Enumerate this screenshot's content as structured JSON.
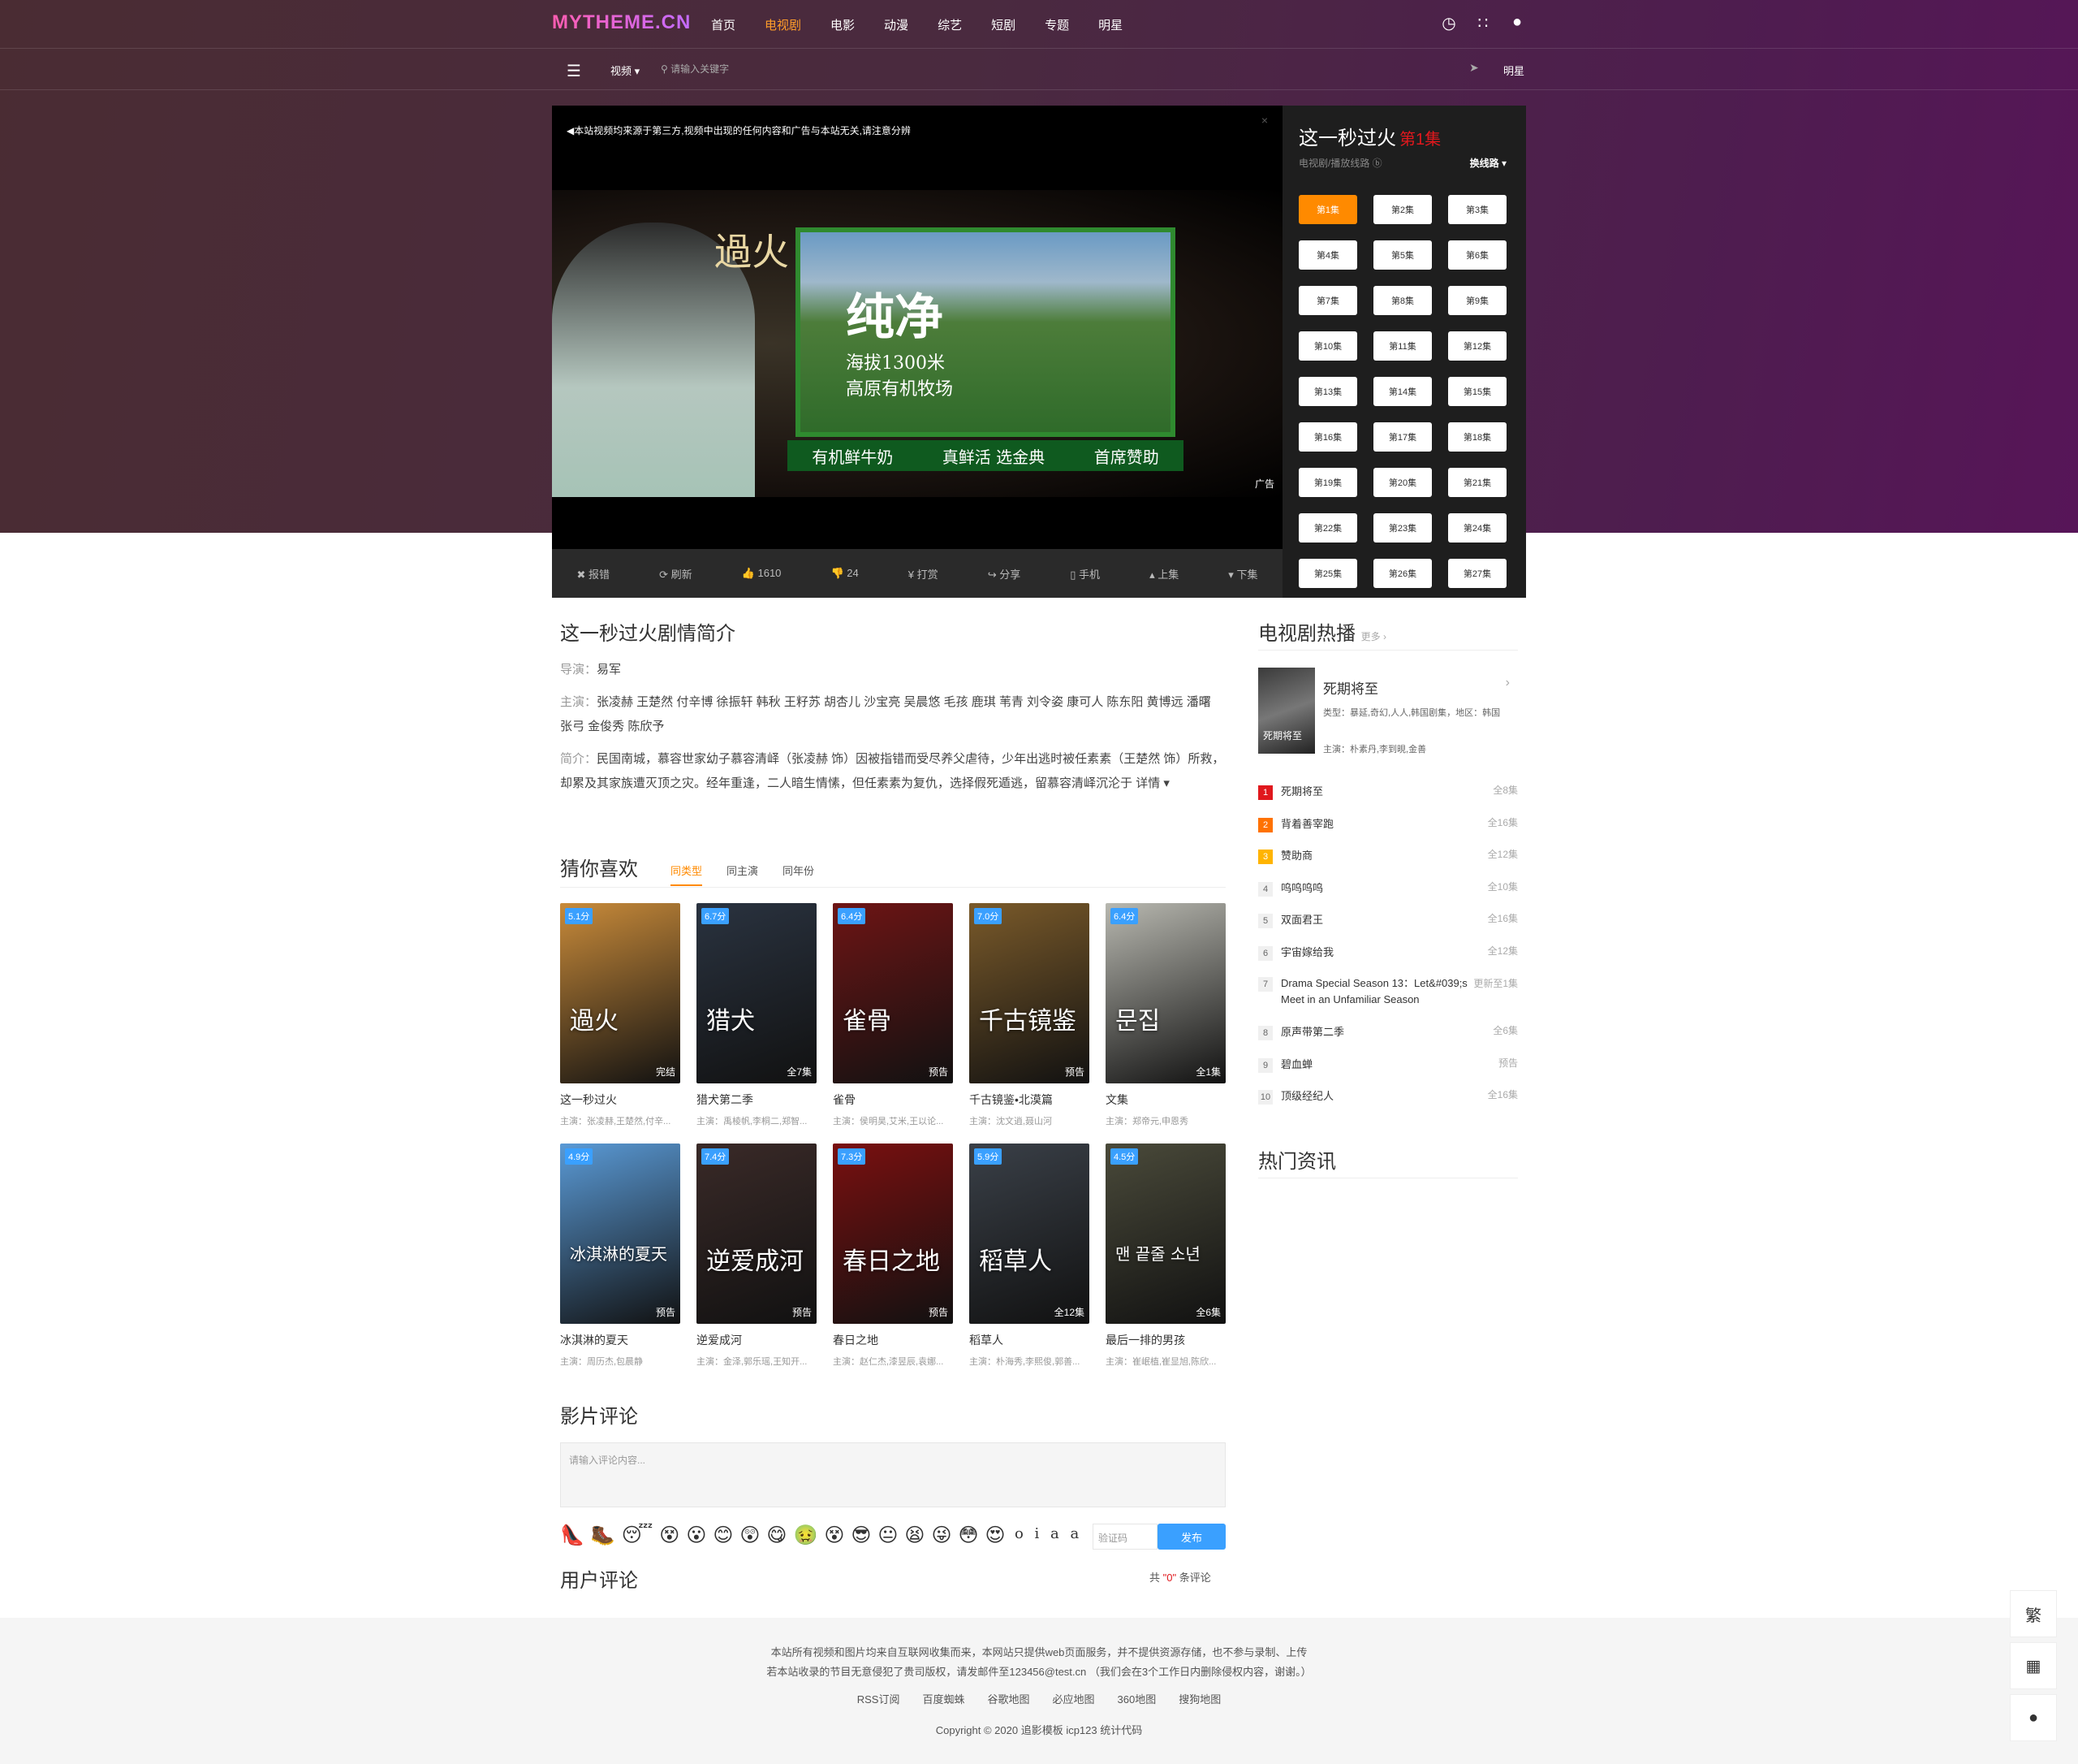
{
  "header": {
    "logo": "MYTHEME.CN",
    "nav": [
      "首页",
      "电视剧",
      "电影",
      "动漫",
      "综艺",
      "短剧",
      "专题",
      "明星"
    ],
    "nav_active_index": 1,
    "icons": [
      "clock-icon",
      "rss-icon",
      "user-icon"
    ]
  },
  "subbar": {
    "category": "视频",
    "search_placeholder": "请输入关键字",
    "right_label": "明星"
  },
  "player": {
    "notice": "本站视频均来源于第三方,视频中出现的任何内容和广告与本站无关,请注意分辨",
    "ad_texts": {
      "vertical": "過火",
      "big": "纯净",
      "line1": "海拔1300米",
      "line2": "高原有机牧场",
      "ribbon_left": "有机鲜牛奶",
      "ribbon_mid": "真鲜活 选金典",
      "ribbon_right": "首席赞助",
      "ad_badge": "广告"
    },
    "toolbar": [
      "报错",
      "刷新",
      "1610",
      "24",
      "打赏",
      "分享",
      "手机",
      "上集",
      "下集"
    ]
  },
  "episodes": {
    "title": "这一秒过火",
    "current": "第1集",
    "sub": "电视剧/播放线路",
    "switch": "换线路",
    "list": [
      "第1集",
      "第2集",
      "第3集",
      "第4集",
      "第5集",
      "第6集",
      "第7集",
      "第8集",
      "第9集",
      "第10集",
      "第11集",
      "第12集",
      "第13集",
      "第14集",
      "第15集",
      "第16集",
      "第17集",
      "第18集",
      "第19集",
      "第20集",
      "第21集",
      "第22集",
      "第23集",
      "第24集",
      "第25集",
      "第26集",
      "第27集"
    ]
  },
  "intro": {
    "title": "这一秒过火剧情简介",
    "director_label": "导演：",
    "director": "易军",
    "cast_label": "主演：",
    "cast": "张凌赫 王楚然 付辛博 徐振轩 韩秋 王籽苏 胡杏儿 沙宝亮 吴晨悠 毛孩 鹿琪 苇青 刘令姿 康可人 陈东阳 黄博远 潘曙 张弓 金俊秀 陈欣予",
    "summary_label": "简介：",
    "summary": "民国南城，慕容世家幼子慕容清峄（张凌赫 饰）因被指错而受尽养父虐待，少年出逃时被任素素（王楚然 饰）所救，却累及其家族遭灭顶之灾。经年重逢，二人暗生情愫，但任素素为复仇，选择假死遁逃，留慕容清峄沉沦于",
    "more": "详情"
  },
  "guess": {
    "title": "猜你喜欢",
    "tabs": [
      "同类型",
      "同主演",
      "同年份"
    ],
    "cards": [
      {
        "score": "5.1分",
        "status": "完结",
        "poster_text": "過火",
        "name": "这一秒过火",
        "cast": "主演：张凌赫,王楚然,付辛...",
        "color": "#c98b3a"
      },
      {
        "score": "6.7分",
        "status": "全7集",
        "poster_text": "猎犬",
        "name": "猎犬第二季",
        "cast": "主演：禹棱帆,李桐二,郑智...",
        "color": "#2a3340"
      },
      {
        "score": "6.4分",
        "status": "预告",
        "poster_text": "雀骨",
        "name": "雀骨",
        "cast": "主演：侯明昊,艾米,王以论...",
        "color": "#6e1515"
      },
      {
        "score": "7.0分",
        "status": "预告",
        "poster_text": "千古镜鉴",
        "name": "千古镜鉴•北漠篇",
        "cast": "主演：沈文逍,聂山河",
        "color": "#7a5a2a"
      },
      {
        "score": "6.4分",
        "status": "全1集",
        "poster_text": "문집",
        "name": "文集",
        "cast": "主演：郑帝元,申恩秀",
        "color": "#b8b8b0"
      },
      {
        "score": "4.9分",
        "status": "预告",
        "poster_text": "冰淇淋的夏天",
        "name": "冰淇淋的夏天",
        "cast": "主演：周历杰,包晨静",
        "color": "#5a9ad6"
      },
      {
        "score": "7.4分",
        "status": "预告",
        "poster_text": "逆爱成河",
        "name": "逆爱成河",
        "cast": "主演：金泽,郭乐瑶,王知开...",
        "color": "#3a2a28"
      },
      {
        "score": "7.3分",
        "status": "预告",
        "poster_text": "春日之地",
        "name": "春日之地",
        "cast": "主演：赵仁杰,漆昱辰,袁娜...",
        "color": "#7a1010"
      },
      {
        "score": "5.9分",
        "status": "全12集",
        "poster_text": "稻草人",
        "name": "稻草人",
        "cast": "主演：朴海秀,李熙俊,郭善...",
        "color": "#3a4048"
      },
      {
        "score": "4.5分",
        "status": "全6集",
        "poster_text": "맨 끝줄 소년",
        "name": "最后一排的男孩",
        "cast": "主演：崔岷植,崔显旭,陈欣...",
        "color": "#4a4a3a"
      }
    ]
  },
  "comments": {
    "title": "影片评论",
    "placeholder": "请输入评论内容...",
    "captcha_text": "o i a a",
    "captcha_placeholder": "验证码",
    "post": "发布",
    "user_title": "用户评论",
    "count_prefix": "共",
    "count": "\"0\"",
    "count_suffix": "条评论",
    "emojis": [
      "👠",
      "🥾",
      "😴",
      "😵",
      "😮",
      "😊",
      "😲",
      "😋",
      "🤢",
      "😵",
      "😎",
      "😐",
      "😫",
      "😜",
      "😳",
      "😍"
    ]
  },
  "sidebar": {
    "hot_title": "电视剧热播",
    "more": "更多",
    "featured": {
      "title": "死期将至",
      "type_line": "类型：暴延,奇幻,人人,韩国剧集，地区：韩国",
      "cast_line": "主演：朴素丹,李到晛,金善",
      "poster_text": "死期将至"
    },
    "ranks": [
      {
        "no": "1",
        "name": "死期将至",
        "status": "全8集"
      },
      {
        "no": "2",
        "name": "背着善宰跑",
        "status": "全16集"
      },
      {
        "no": "3",
        "name": "赞助商",
        "status": "全12集"
      },
      {
        "no": "4",
        "name": "呜呜呜呜",
        "status": "全10集"
      },
      {
        "no": "5",
        "name": "双面君王",
        "status": "全16集"
      },
      {
        "no": "6",
        "name": "宇宙嫁给我",
        "status": "全12集"
      },
      {
        "no": "7",
        "name": "Drama Special Season 13：Let&#039;s Meet in an Unfamiliar Season",
        "status": "更新至1集"
      },
      {
        "no": "8",
        "name": "原声带第二季",
        "status": "全6集"
      },
      {
        "no": "9",
        "name": "碧血蝉",
        "status": "预告"
      },
      {
        "no": "10",
        "name": "顶级经纪人",
        "status": "全16集"
      }
    ],
    "news_title": "热门资讯"
  },
  "footer": {
    "line1": "本站所有视频和图片均来自互联网收集而来，本网站只提供web页面服务，并不提供资源存储，也不参与录制、上传",
    "line2": "若本站收录的节目无意侵犯了贵司版权，请发邮件至123456@test.cn （我们会在3个工作日内删除侵权内容，谢谢。）",
    "links": [
      "RSS订阅",
      "百度蜘蛛",
      "谷歌地图",
      "必应地图",
      "360地图",
      "搜狗地图"
    ],
    "copyright": "Copyright © 2020 追影模板 icp123 统计代码"
  },
  "float_buttons": [
    "繁"
  ],
  "colors": {
    "accent": "#ff8a00",
    "red": "#e0181d",
    "blue": "#3aa0ff"
  }
}
